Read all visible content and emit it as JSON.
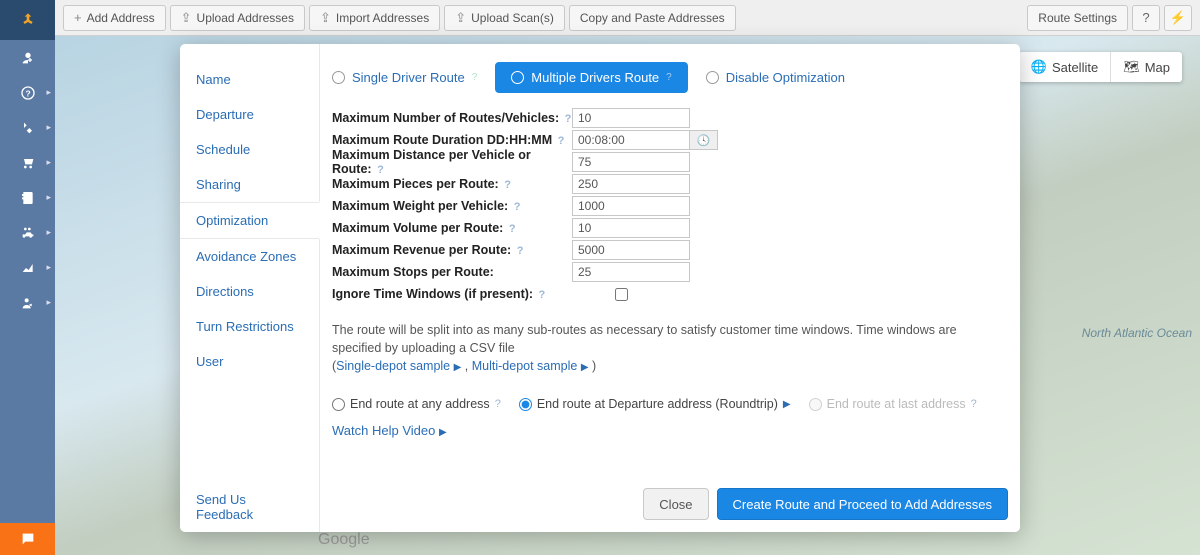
{
  "colors": {
    "accent": "#1b87e5",
    "link": "#2a6db5",
    "sidebar": "#5a7aa3",
    "chat": "#f97316"
  },
  "toolbar": {
    "add_address": "Add Address",
    "upload_addresses": "Upload Addresses",
    "import_addresses": "Import Addresses",
    "upload_scans": "Upload Scan(s)",
    "copy_paste": "Copy and Paste Addresses",
    "route_settings": "Route Settings"
  },
  "map_toggle": {
    "satellite": "Satellite",
    "map": "Map"
  },
  "geo_label": "North\nAtlantic\nOcean",
  "google_wm": "Google",
  "modal": {
    "sidebar": {
      "items": [
        "Name",
        "Departure",
        "Schedule",
        "Sharing",
        "Optimization",
        "Avoidance Zones",
        "Directions",
        "Turn Restrictions",
        "User"
      ],
      "active_index": 4,
      "footer_link": "Send Us Feedback"
    },
    "tabs": {
      "single": "Single Driver Route",
      "multiple": "Multiple Drivers Route",
      "disable": "Disable Optimization",
      "active": "multiple"
    },
    "fields": {
      "max_routes": {
        "label": "Maximum Number of Routes/Vehicles:",
        "value": "10",
        "help": true
      },
      "max_duration": {
        "label": "Maximum Route Duration DD:HH:MM",
        "value": "00:08:00",
        "help": true
      },
      "max_distance": {
        "label": "Maximum Distance per Vehicle or Route:",
        "value": "75",
        "help": true
      },
      "max_pieces": {
        "label": "Maximum Pieces per Route:",
        "value": "250",
        "help": true
      },
      "max_weight": {
        "label": "Maximum Weight per Vehicle:",
        "value": "1000",
        "help": true
      },
      "max_volume": {
        "label": "Maximum Volume per Route:",
        "value": "10",
        "help": true
      },
      "max_revenue": {
        "label": "Maximum Revenue per Route:",
        "value": "5000",
        "help": true
      },
      "max_stops": {
        "label": "Maximum Stops per Route:",
        "value": "25",
        "help": false
      },
      "ignore_time_windows": {
        "label": "Ignore Time Windows (if present):",
        "checked": false,
        "help": true
      }
    },
    "note": "The route will be split into as many sub-routes as necessary to satisfy customer time windows. Time windows are specified by uploading a CSV file",
    "samples": {
      "single": "Single-depot sample",
      "multi": "Multi-depot sample"
    },
    "end_route": {
      "any": "End route at any address",
      "departure": "End route at Departure address (Roundtrip)",
      "last": "End route at last address",
      "selected": "departure"
    },
    "watch_help_link": "Watch Help Video",
    "buttons": {
      "close": "Close",
      "create": "Create Route and Proceed to Add Addresses"
    }
  }
}
